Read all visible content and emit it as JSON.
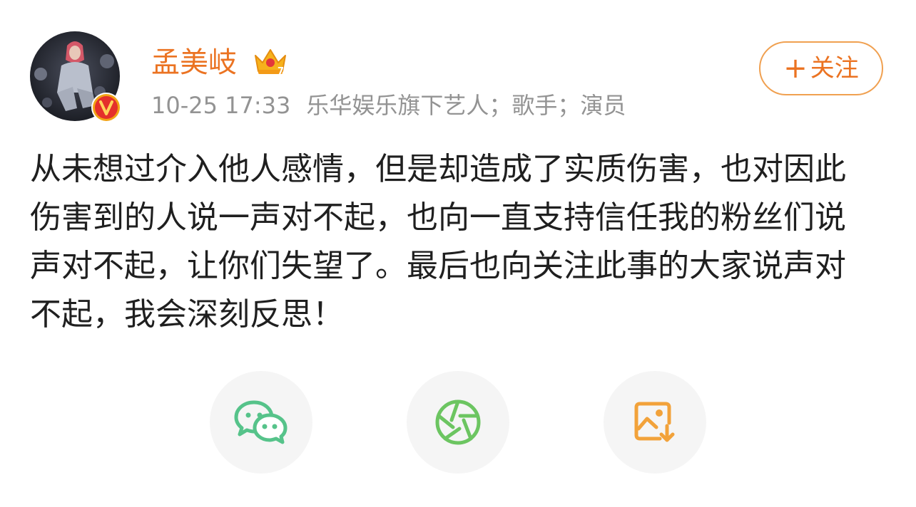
{
  "post": {
    "author": {
      "name": "孟美岐",
      "avatar": "avatar-photo",
      "verified_badge": "V",
      "crown_icon": "crown-icon"
    },
    "time": "10-25 17:33",
    "source": "乐华娱乐旗下艺人；歌手；演员",
    "follow_button": {
      "plus": "+",
      "label": "关注"
    },
    "text": "从未想过介入他人感情，但是却造成了实质伤害，也对因此伤害到的人说一声对不起，也向一直支持信任我的粉丝们说声对不起，让你们失望了。最后也向关注此事的大家说声对不起，我会深刻反思！"
  },
  "share_actions": [
    {
      "icon": "wechat-icon",
      "color": "#56c38a"
    },
    {
      "icon": "moments-camera-icon",
      "color": "#6cc561"
    },
    {
      "icon": "save-image-icon",
      "color": "#f2a23a"
    }
  ],
  "colors": {
    "name": "#eb7322",
    "meta": "#939393",
    "follow_border": "#f0a050",
    "text": "#1f1f1f",
    "share_bg": "#f5f5f5"
  }
}
